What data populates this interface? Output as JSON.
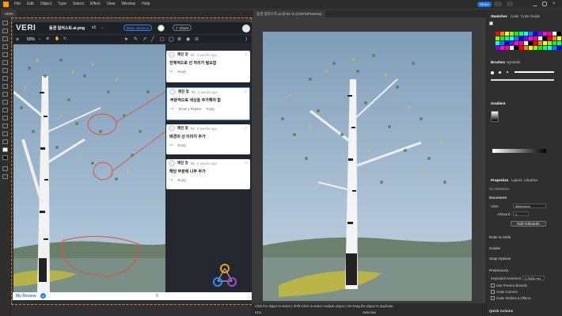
{
  "menubar": {
    "items": [
      "File",
      "Edit",
      "Object",
      "Type",
      "Select",
      "Effect",
      "View",
      "Window",
      "Help"
    ],
    "share_label": "Share"
  },
  "tabs": {
    "left_tab": "VERI",
    "right_tab": "동경 일러스트.ai @ 51 % (CMYK/Preview)"
  },
  "plugin": {
    "logo": "VERI",
    "file_name": "동경 일러스트.ai.png",
    "version": "v1",
    "make_decision": "Make decision",
    "share": "Share",
    "zoom": "50%",
    "general_comment": "General Comment",
    "my_review": "My Review",
    "comments": [
      {
        "author": "해진 정",
        "num": "#1",
        "time": "2 weeks ago",
        "text": "전체적으로 선 처리가 필요함",
        "reply": "Reply"
      },
      {
        "author": "해진 정",
        "num": "#2",
        "time": "2 weeks ago",
        "text": "부분적으로 색상을 추가해야 함",
        "show_replies": "Show 1 Replies",
        "reply": "Reply"
      },
      {
        "author": "해진 정",
        "num": "#3",
        "time": "2 weeks ago",
        "text": "배경의 산 이미지 추가",
        "reply": "Reply"
      },
      {
        "author": "해진 정",
        "num": "#4",
        "time": "2 weeks ago",
        "text": "해당 부분에 나무 추가",
        "reply": "Reply"
      }
    ]
  },
  "status": {
    "hint": "Click the object to select  |  Shift+Click to select multiple object  |  Alt+Drag the object to duplicate",
    "zoom": "51%",
    "tool": "Selection"
  },
  "panels": {
    "swatches_tab": "Swatches",
    "color_tab": "Color",
    "color_guide_tab": "Color Guide",
    "brushes_tab": "Brushes",
    "symbols_tab": "Symbols",
    "gradient_tab": "Gradient",
    "properties_tab": "Properties",
    "layers_tab": "Layers",
    "libraries_tab": "Libraries",
    "no_selection": "No Selection",
    "document": "Document",
    "units_label": "Units",
    "units_value": "Millimeters",
    "artboard_label": "Artboard:",
    "artboard_value": "1",
    "edit_artboards": "Edit Artboards",
    "rulers_grids": "Ruler & Grids",
    "guides": "Guides",
    "snap_options": "Snap Options",
    "preferences": "Preferences",
    "keyboard_increment_label": "Keyboard Increment:",
    "keyboard_increment_value": "0.3528 mm",
    "use_preview_bounds": "Use Preview Bounds",
    "scale_corners": "Scale Corners",
    "scale_strokes": "Scale Strokes & Effects",
    "quick_actions": "Quick Actions"
  },
  "colors": {
    "accent": "#1473e6",
    "artboard_border": "#e07b30",
    "sky": "#9fb9cf"
  }
}
